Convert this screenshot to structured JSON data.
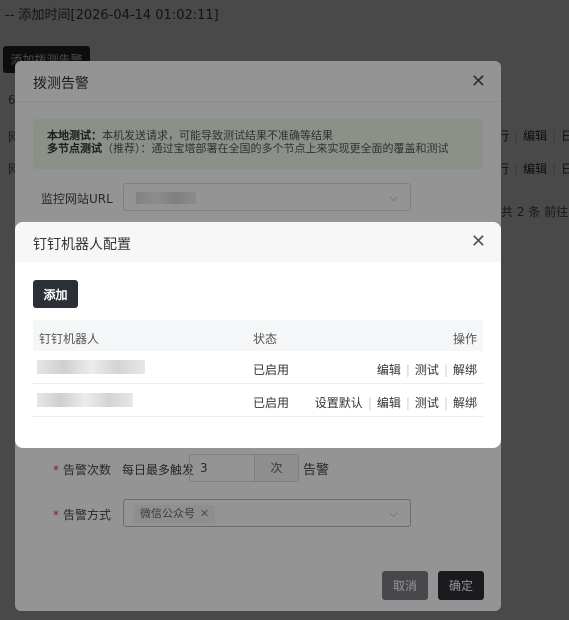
{
  "background": {
    "header_text": "-- 添加时间[2026-04-14 01:02:11]",
    "add_button": "添加拨测告警",
    "row_actions": [
      "行",
      "编辑",
      "日"
    ],
    "pager": "共 2 条  前往",
    "left_fragments": [
      "6",
      "网",
      "网"
    ]
  },
  "dialog_monitor": {
    "title": "拨测告警",
    "notice": {
      "line1_label": "本地测试：",
      "line1_text": "本机发送请求，可能导致测试结果不准确等结果",
      "line2_label": "多节点测试",
      "line2_note": "（推荐）：",
      "line2_text": "通过宝塔部署在全国的多个节点上来实现更全面的覆盖和测试"
    },
    "url_label": "监控网站URL",
    "count_label": "告警次数",
    "count_prefix": "每日最多触发",
    "count_value": "3",
    "count_unit": "次",
    "count_suffix": "告警",
    "method_label": "告警方式",
    "method_tag": "微信公众号",
    "cancel_label": "取消",
    "ok_label": "确定"
  },
  "dialog_dingtalk": {
    "title": "钉钉机器人配置",
    "add_label": "添加",
    "columns": {
      "name": "钉钉机器人",
      "status": "状态",
      "ops": "操作"
    },
    "rows": [
      {
        "status": "已启用",
        "ops": [
          "编辑",
          "测试",
          "解绑"
        ]
      },
      {
        "status": "已启用",
        "ops": [
          "设置默认",
          "编辑",
          "测试",
          "解绑"
        ]
      }
    ]
  },
  "colors": {
    "dark_button": "#2b2f36",
    "notice_bg": "#f0f9eb",
    "required": "#e0393e"
  }
}
